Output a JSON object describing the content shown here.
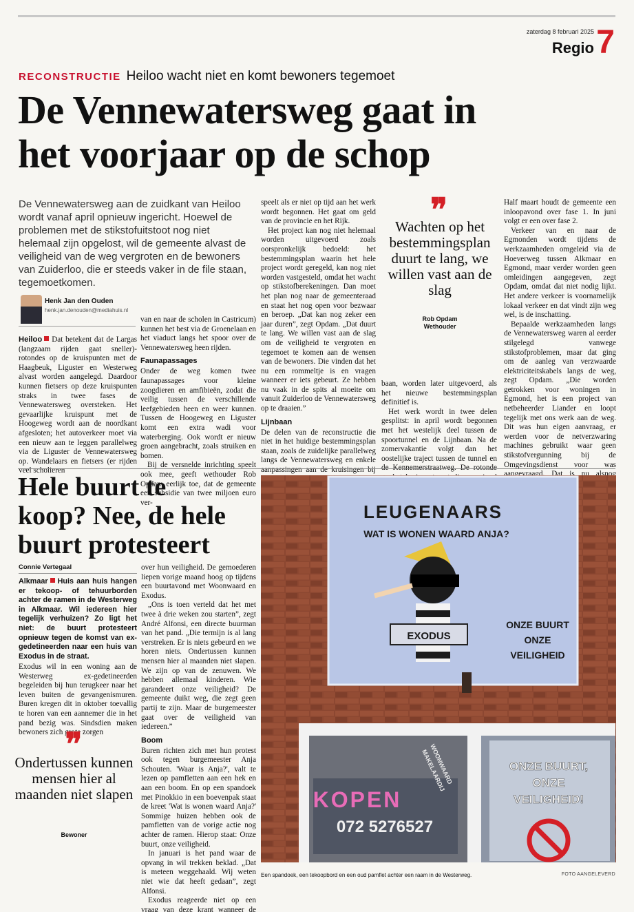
{
  "header": {
    "date": "zaterdag 8 februari 2025",
    "section": "Regio",
    "page_number": "7",
    "accent_color": "#d41f26"
  },
  "article1": {
    "kicker_label": "RECONSTRUCTIE",
    "kicker_text": "Heiloo wacht niet en komt bewoners tegemoet",
    "headline_line1": "De Vennewatersweg gaat in",
    "headline_line2": "het voorjaar op de schop",
    "intro": "De Vennewatersweg aan de zuidkant van Heiloo wordt vanaf april opnieuw ingericht. Hoewel de problemen met de stikstofuitstoot nog niet helemaal zijn opgelost, wil de gemeente alvast de veiligheid van de weg vergroten en de bewoners van Zuiderloo, die er steeds vaker in de file staan, tegemoetkomen.",
    "author": "Henk Jan den Ouden",
    "email": "henk.jan.denouden@mediahuis.nl",
    "col1_place": "Heiloo",
    "col1_text": "Dat betekent dat de Largas (langzaam rijden gaat sneller)-rotondes op de kruispunten met de Haagbeuk, Liguster en Westerweg alvast worden aangelegd. Daardoor kunnen fietsers op deze kruispunten straks in twee fases de Vennewatersweg oversteken. Het gevaarlijke kruispunt met de Hoogeweg wordt aan de noordkant afgesloten; het autoverkeer moet via een nieuw aan te leggen parallelweg via de Liguster de Vennewatersweg op. Wandelaars en fietsers (er rijden veel scholieren",
    "col2_p1": "van en naar de scholen in Castricum) kunnen het best via de Groenelaan en het viaduct langs het spoor over de Vennewatersweg heen rijden.",
    "col2_h": "Faunapassages",
    "col2_p2": "Onder de weg komen twee faunapassages voor kleine zoogdieren en amfibieën, zodat die veilig tussen de verschillende leefgebieden heen en weer kunnen. Tussen de Hoogeweg en Liguster komt een extra wadi voor waterberging. Ook wordt er nieuw groen aangebracht, zoals struiken en bomen.",
    "col2_p3": "Bij de versnelde inrichting speelt ook mee, geeft wethouder Rob Opdam eerlijk toe, dat de gemeente een subsidie van twee miljoen euro ver-",
    "col3_p1": "speelt als er niet op tijd aan het werk wordt begonnen. Het gaat om geld van de provincie en het Rijk.",
    "col3_p2": "Het project kan nog niet helemaal worden uitgevoerd zoals oorspronkelijk bedoeld: het bestemmingsplan waarin het hele project wordt geregeld, kan nog niet worden vastgesteld, omdat het wacht op stikstofberekeningen. Dan moet het plan nog naar de gemeenteraad en staat het nog open voor bezwaar en beroep. „Dat kan nog zeker een jaar duren”, zegt Opdam. „Dat duurt te lang. We willen vast aan de slag om de veiligheid te vergroten en tegemoet te komen aan de wensen van de bewoners. Die vinden dat het nu een rommeltje is en vragen wanneer er iets gebeurt. Ze hebben nu vaak in de spits al moeite om vanuit Zuiderloo de Vennewatersweg op te draaien.”",
    "col3_h": "Lijnbaan",
    "col3_p3": "De delen van de reconstructie die niet in het huidige bestemmingsplan staan, zoals de zuidelijke parallelweg langs de Vennewatersweg en enkele aanpassingen aan de kruisingen bij de Westerweg en de Lijn-",
    "quote": "Wachten op het bestemmingsplan duurt te lang, we willen vast aan de slag",
    "quote_name": "Rob Opdam",
    "quote_role": "Wethouder",
    "col4_p1": "baan, worden later uitgevoerd, als het nieuwe bestemmingsplan definitief is.",
    "col4_p2": "Het werk wordt in twee delen gesplitst: in april wordt begonnen met het westelijk deel tussen de spoortunnel en de Lijnbaan. Na de zomervakantie volgt dan het oostelijke traject tussen de tunnel en de Kennemerstraatweg. De rotonde op het kruispunt met die weg is al klaar.",
    "col5_p1": "Half maart houdt de gemeente een inloopavond over fase 1. In juni volgt er een over fase 2.",
    "col5_p2": "Verkeer van en naar de Egmonden wordt tijdens de werkzaamheden omgeleid via de Hoeverweg tussen Alkmaar en Egmond, maar verder worden geen omleidingen aangegeven, zegt Opdam, omdat dat niet nodig lijkt. Het andere verkeer is voornamelijk lokaal verkeer en dat vindt zijn weg wel, is de inschatting.",
    "col5_p3": "Bepaalde werkzaamheden langs de Vennewatersweg waren al eerder stilgelegd vanwege stikstofproblemen, maar dat ging om de aanleg van verzwaarde elektriciteitskabels langs de weg, zegt Opdam. „Die worden getrokken voor woningen in Egmond, het is een project van netbeheerder Liander en loopt tegelijk met ons werk aan de weg. Dit was hun eigen aanvraag, er werden voor de netverzwaring machines gebruikt waar geen stikstofvergunning bij de Omgevingsdienst voor was aangevraagd. Dat is nu alsnog gebeurd. Dat werk wordt voortgezet, afhankelijk van de vergunning met traditioneel of elektrisch materieel.”"
  },
  "article2": {
    "headline_line1": "Hele buurt te",
    "headline_line2": "koop? Nee, de hele",
    "headline_line3": "buurt protesteert",
    "author": "Connie Vertegaal",
    "lead_place": "Alkmaar",
    "lead_text": "Huis aan huis hangen er tekoop- of tehuurborden achter de ramen in de Westerweg in Alkmaar. Wil iedereen hier tegelijk verhuizen? Zo ligt het niet: de buurt protesteert opnieuw tegen de komst van ex-gedetineerden naar een huis van Exodus in de straat.",
    "col1_p1": "Exodus wil in een woning aan de Westerweg ex-gedetineerden begeleiden bij hun terugkeer naar het leven buiten de gevangenismuren. Buren kregen dit in oktober toevallig te horen van een aannemer die in het pand bezig was. Sindsdien maken bewoners zich grote zorgen",
    "quote": "Ondertussen kunnen mensen hier al maanden niet slapen",
    "quote_role": "Bewoner",
    "col2_p1": "over hun veiligheid. De gemoederen liepen vorige maand hoog op tijdens een buurtavond met Woonwaard en Exodus.",
    "col2_p2": "„Ons is toen verteld dat het met twee à drie weken zou starten”, zegt André Alfonsi, een directe buurman van het pand. „Die termijn is al lang verstreken. Er is niets gebeurd en we horen niets. Ondertussen kunnen mensen hier al maanden niet slapen. We zijn op van de zenuwen. We hebben allemaal kinderen. Wie garandeert onze veiligheid? De gemeente duikt weg, die zegt geen partij te zijn. Maar de burgemeester gaat over de veiligheid van iedereen.”",
    "col2_h": "Boom",
    "col2_p3": "Buren richten zich met hun protest ook tegen burgemeester Anja Schouten. 'Waar is Anja?', valt te lezen op pamfletten aan een hek en aan een boom. En op een spandoek met Pinokkio in een boevenpak staat de kreet 'Wat is wonen waard Anja?' Sommige huizen hebben ook de pamfletten van de vorige actie nog achter de ramen. Hierop staat: Onze buurt, onze veiligheid.",
    "col2_p4": "In januari is het pand waar de opvang in wil trekken beklad. „Dat is meteen weggehaald. Wij weten niet wie dat heeft gedaan”, zegt Alfonsi.",
    "col2_p5": "Exodus reageerde niet op een vraag van deze krant wanneer de begeleiding van ex-gedetineerden aan de Westerweg start.",
    "photo": {
      "banner_title": "LEUGENAARS",
      "banner_subtitle": "WAT IS WONEN WAARD ANJA?",
      "banner_sign": "EXODUS",
      "banner_slogan_1": "ONZE BUURT",
      "banner_slogan_2": "ONZE",
      "banner_slogan_3": "VEILIGHEID",
      "window_sign_kopen": "KOPEN",
      "window_sign_phone": "072 5276527",
      "window_sign_agency_1": "WOONWAARD",
      "window_sign_agency_2": "MAKELAARDIJ",
      "window_poster_1": "ONZE BUURT,",
      "window_poster_2": "ONZE",
      "window_poster_3": "VEILIGHEID!",
      "banner_bg": "#b9c6e6",
      "brick": "#8a4a32"
    },
    "caption": "Een spandoek, een tekoopbord en een oud pamflet achter een raam in de Westerweg.",
    "credit": "FOTO AANGELEVERD"
  }
}
